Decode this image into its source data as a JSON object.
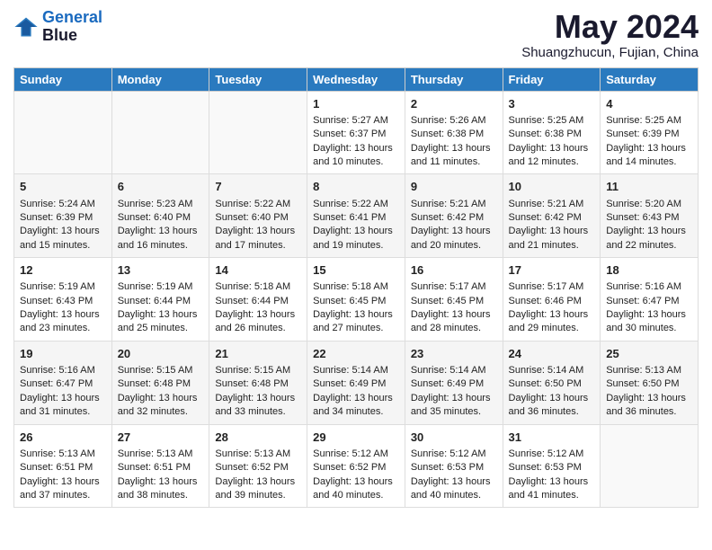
{
  "header": {
    "logo_line1": "General",
    "logo_line2": "Blue",
    "title": "May 2024",
    "subtitle": "Shuangzhucun, Fujian, China"
  },
  "days_of_week": [
    "Sunday",
    "Monday",
    "Tuesday",
    "Wednesday",
    "Thursday",
    "Friday",
    "Saturday"
  ],
  "weeks": [
    [
      {
        "day": "",
        "data": ""
      },
      {
        "day": "",
        "data": ""
      },
      {
        "day": "",
        "data": ""
      },
      {
        "day": "1",
        "data": "Sunrise: 5:27 AM\nSunset: 6:37 PM\nDaylight: 13 hours and 10 minutes."
      },
      {
        "day": "2",
        "data": "Sunrise: 5:26 AM\nSunset: 6:38 PM\nDaylight: 13 hours and 11 minutes."
      },
      {
        "day": "3",
        "data": "Sunrise: 5:25 AM\nSunset: 6:38 PM\nDaylight: 13 hours and 12 minutes."
      },
      {
        "day": "4",
        "data": "Sunrise: 5:25 AM\nSunset: 6:39 PM\nDaylight: 13 hours and 14 minutes."
      }
    ],
    [
      {
        "day": "5",
        "data": "Sunrise: 5:24 AM\nSunset: 6:39 PM\nDaylight: 13 hours and 15 minutes."
      },
      {
        "day": "6",
        "data": "Sunrise: 5:23 AM\nSunset: 6:40 PM\nDaylight: 13 hours and 16 minutes."
      },
      {
        "day": "7",
        "data": "Sunrise: 5:22 AM\nSunset: 6:40 PM\nDaylight: 13 hours and 17 minutes."
      },
      {
        "day": "8",
        "data": "Sunrise: 5:22 AM\nSunset: 6:41 PM\nDaylight: 13 hours and 19 minutes."
      },
      {
        "day": "9",
        "data": "Sunrise: 5:21 AM\nSunset: 6:42 PM\nDaylight: 13 hours and 20 minutes."
      },
      {
        "day": "10",
        "data": "Sunrise: 5:21 AM\nSunset: 6:42 PM\nDaylight: 13 hours and 21 minutes."
      },
      {
        "day": "11",
        "data": "Sunrise: 5:20 AM\nSunset: 6:43 PM\nDaylight: 13 hours and 22 minutes."
      }
    ],
    [
      {
        "day": "12",
        "data": "Sunrise: 5:19 AM\nSunset: 6:43 PM\nDaylight: 13 hours and 23 minutes."
      },
      {
        "day": "13",
        "data": "Sunrise: 5:19 AM\nSunset: 6:44 PM\nDaylight: 13 hours and 25 minutes."
      },
      {
        "day": "14",
        "data": "Sunrise: 5:18 AM\nSunset: 6:44 PM\nDaylight: 13 hours and 26 minutes."
      },
      {
        "day": "15",
        "data": "Sunrise: 5:18 AM\nSunset: 6:45 PM\nDaylight: 13 hours and 27 minutes."
      },
      {
        "day": "16",
        "data": "Sunrise: 5:17 AM\nSunset: 6:45 PM\nDaylight: 13 hours and 28 minutes."
      },
      {
        "day": "17",
        "data": "Sunrise: 5:17 AM\nSunset: 6:46 PM\nDaylight: 13 hours and 29 minutes."
      },
      {
        "day": "18",
        "data": "Sunrise: 5:16 AM\nSunset: 6:47 PM\nDaylight: 13 hours and 30 minutes."
      }
    ],
    [
      {
        "day": "19",
        "data": "Sunrise: 5:16 AM\nSunset: 6:47 PM\nDaylight: 13 hours and 31 minutes."
      },
      {
        "day": "20",
        "data": "Sunrise: 5:15 AM\nSunset: 6:48 PM\nDaylight: 13 hours and 32 minutes."
      },
      {
        "day": "21",
        "data": "Sunrise: 5:15 AM\nSunset: 6:48 PM\nDaylight: 13 hours and 33 minutes."
      },
      {
        "day": "22",
        "data": "Sunrise: 5:14 AM\nSunset: 6:49 PM\nDaylight: 13 hours and 34 minutes."
      },
      {
        "day": "23",
        "data": "Sunrise: 5:14 AM\nSunset: 6:49 PM\nDaylight: 13 hours and 35 minutes."
      },
      {
        "day": "24",
        "data": "Sunrise: 5:14 AM\nSunset: 6:50 PM\nDaylight: 13 hours and 36 minutes."
      },
      {
        "day": "25",
        "data": "Sunrise: 5:13 AM\nSunset: 6:50 PM\nDaylight: 13 hours and 36 minutes."
      }
    ],
    [
      {
        "day": "26",
        "data": "Sunrise: 5:13 AM\nSunset: 6:51 PM\nDaylight: 13 hours and 37 minutes."
      },
      {
        "day": "27",
        "data": "Sunrise: 5:13 AM\nSunset: 6:51 PM\nDaylight: 13 hours and 38 minutes."
      },
      {
        "day": "28",
        "data": "Sunrise: 5:13 AM\nSunset: 6:52 PM\nDaylight: 13 hours and 39 minutes."
      },
      {
        "day": "29",
        "data": "Sunrise: 5:12 AM\nSunset: 6:52 PM\nDaylight: 13 hours and 40 minutes."
      },
      {
        "day": "30",
        "data": "Sunrise: 5:12 AM\nSunset: 6:53 PM\nDaylight: 13 hours and 40 minutes."
      },
      {
        "day": "31",
        "data": "Sunrise: 5:12 AM\nSunset: 6:53 PM\nDaylight: 13 hours and 41 minutes."
      },
      {
        "day": "",
        "data": ""
      }
    ]
  ]
}
